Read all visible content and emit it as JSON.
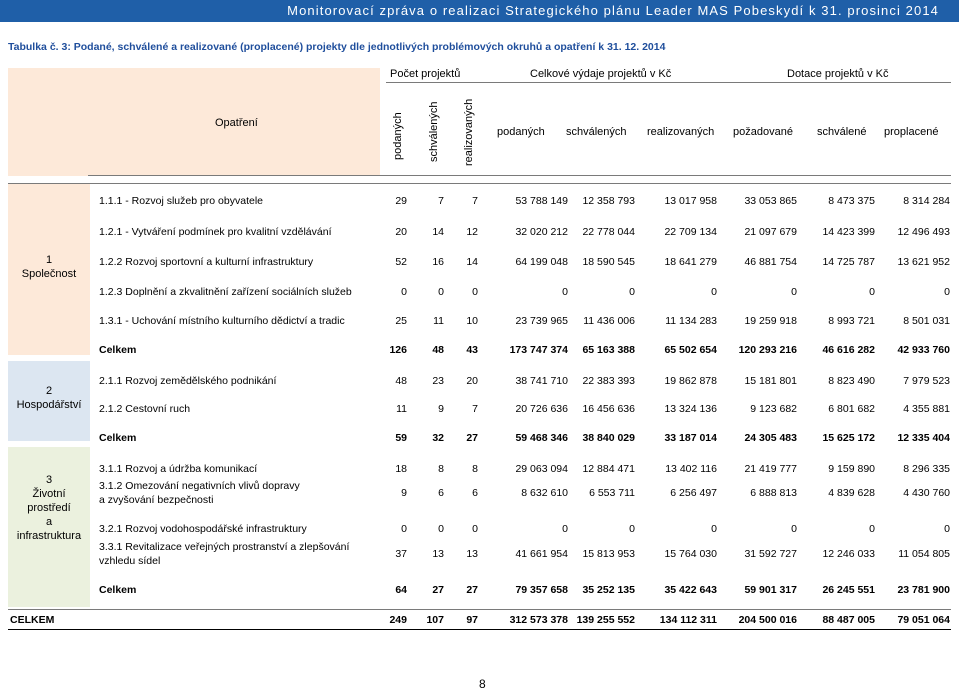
{
  "banner": "Monitorovací zpráva o realizaci Strategického plánu Leader MAS Pobeskydí k 31. prosinci 2014",
  "caption": "Tabulka č. 3: Podané, schválené a realizované (proplacené) projekty dle jednotlivých problémových okruhů a opatření k 31. 12. 2014",
  "header": {
    "opatreni": "Opatření",
    "group_counts": "Počet projektů",
    "group_costs": "Celkové výdaje projektů v Kč",
    "group_subsidy": "Dotace projektů v Kč",
    "count_cols": [
      "podaných",
      "schválených",
      "realizovaných"
    ],
    "money_cols": [
      "podaných",
      "schválených",
      "realizovaných",
      "požadované",
      "schválené",
      "proplacené"
    ]
  },
  "groups": [
    {
      "label": [
        "1",
        "Společnost"
      ]
    },
    {
      "label": [
        "2",
        "Hospodářství"
      ]
    },
    {
      "label": [
        "3",
        "Životní",
        "prostředí",
        "a",
        "infrastruktura"
      ]
    }
  ],
  "rows": [
    {
      "name": [
        "1.1.1 - Rozvoj služeb pro obyvatele"
      ],
      "bold": false,
      "values": [
        "29",
        "7",
        "7",
        "53 788 149",
        "12 358 793",
        "13 017 958",
        "33 053 865",
        "8 473 375",
        "8 314 284"
      ]
    },
    {
      "name": [
        "1.2.1 - Vytváření podmínek pro kvalitní vzdělávání"
      ],
      "bold": false,
      "values": [
        "20",
        "14",
        "12",
        "32 020 212",
        "22 778 044",
        "22 709 134",
        "21 097 679",
        "14 423 399",
        "12 496 493"
      ]
    },
    {
      "name": [
        "1.2.2 Rozvoj sportovní a kulturní infrastruktury"
      ],
      "bold": false,
      "values": [
        "52",
        "16",
        "14",
        "64 199 048",
        "18 590 545",
        "18 641 279",
        "46 881 754",
        "14 725 787",
        "13 621 952"
      ]
    },
    {
      "name": [
        "1.2.3 Doplnění a zkvalitnění zařízení sociálních služeb"
      ],
      "bold": false,
      "values": [
        "0",
        "0",
        "0",
        "0",
        "0",
        "0",
        "0",
        "0",
        "0"
      ]
    },
    {
      "name": [
        "1.3.1 - Uchování místního kulturního dědictví a tradic"
      ],
      "bold": false,
      "values": [
        "25",
        "11",
        "10",
        "23 739 965",
        "11 436 006",
        "11 134 283",
        "19 259 918",
        "8 993 721",
        "8 501 031"
      ]
    },
    {
      "name": [
        "Celkem"
      ],
      "bold": true,
      "values": [
        "126",
        "48",
        "43",
        "173 747 374",
        "65 163 388",
        "65 502 654",
        "120 293 216",
        "46 616 282",
        "42 933 760"
      ]
    },
    {
      "name": [
        "2.1.1 Rozvoj zemědělského podnikání"
      ],
      "bold": false,
      "values": [
        "48",
        "23",
        "20",
        "38 741 710",
        "22 383 393",
        "19 862 878",
        "15 181 801",
        "8 823 490",
        "7 979 523"
      ]
    },
    {
      "name": [
        "2.1.2 Cestovní ruch"
      ],
      "bold": false,
      "values": [
        "11",
        "9",
        "7",
        "20 726 636",
        "16 456 636",
        "13 324 136",
        "9 123 682",
        "6 801 682",
        "4 355 881"
      ]
    },
    {
      "name": [
        "Celkem"
      ],
      "bold": true,
      "values": [
        "59",
        "32",
        "27",
        "59 468 346",
        "38 840 029",
        "33 187 014",
        "24 305 483",
        "15 625 172",
        "12 335 404"
      ]
    },
    {
      "name": [
        "3.1.1 Rozvoj a údržba komunikací"
      ],
      "bold": false,
      "values": [
        "18",
        "8",
        "8",
        "29 063 094",
        "12 884 471",
        "13 402 116",
        "21 419 777",
        "9 159 890",
        "8 296 335"
      ]
    },
    {
      "name": [
        "3.1.2 Omezování negativních vlivů dopravy",
        "a zvyšování bezpečnosti"
      ],
      "bold": false,
      "values": [
        "9",
        "6",
        "6",
        "8 632 610",
        "6 553 711",
        "6 256 497",
        "6 888 813",
        "4 839 628",
        "4 430 760"
      ]
    },
    {
      "name": [
        "3.2.1 Rozvoj vodohospodářské infrastruktury"
      ],
      "bold": false,
      "values": [
        "0",
        "0",
        "0",
        "0",
        "0",
        "0",
        "0",
        "0",
        "0"
      ]
    },
    {
      "name": [
        "3.3.1 Revitalizace veřejných prostranství a zlepšování",
        "vzhledu sídel"
      ],
      "bold": false,
      "values": [
        "37",
        "13",
        "13",
        "41 661 954",
        "15 813 953",
        "15 764 030",
        "31 592 727",
        "12 246 033",
        "11 054 805"
      ]
    },
    {
      "name": [
        "Celkem"
      ],
      "bold": true,
      "values": [
        "64",
        "27",
        "27",
        "79 357 658",
        "35 252 135",
        "35 422 643",
        "59 901 317",
        "26 245 551",
        "23 781 900"
      ]
    }
  ],
  "total": {
    "name": "CELKEM",
    "values": [
      "249",
      "107",
      "97",
      "312 573 378",
      "139 255 552",
      "134 112 311",
      "204 500 016",
      "88 487 005",
      "79 051 064"
    ]
  },
  "page_number": "8",
  "colors": {
    "banner": "#1f5fa8",
    "caption": "#1f4e9c",
    "group1": "#fde9d9",
    "group2": "#dce6f1",
    "group3": "#ebf1de"
  }
}
